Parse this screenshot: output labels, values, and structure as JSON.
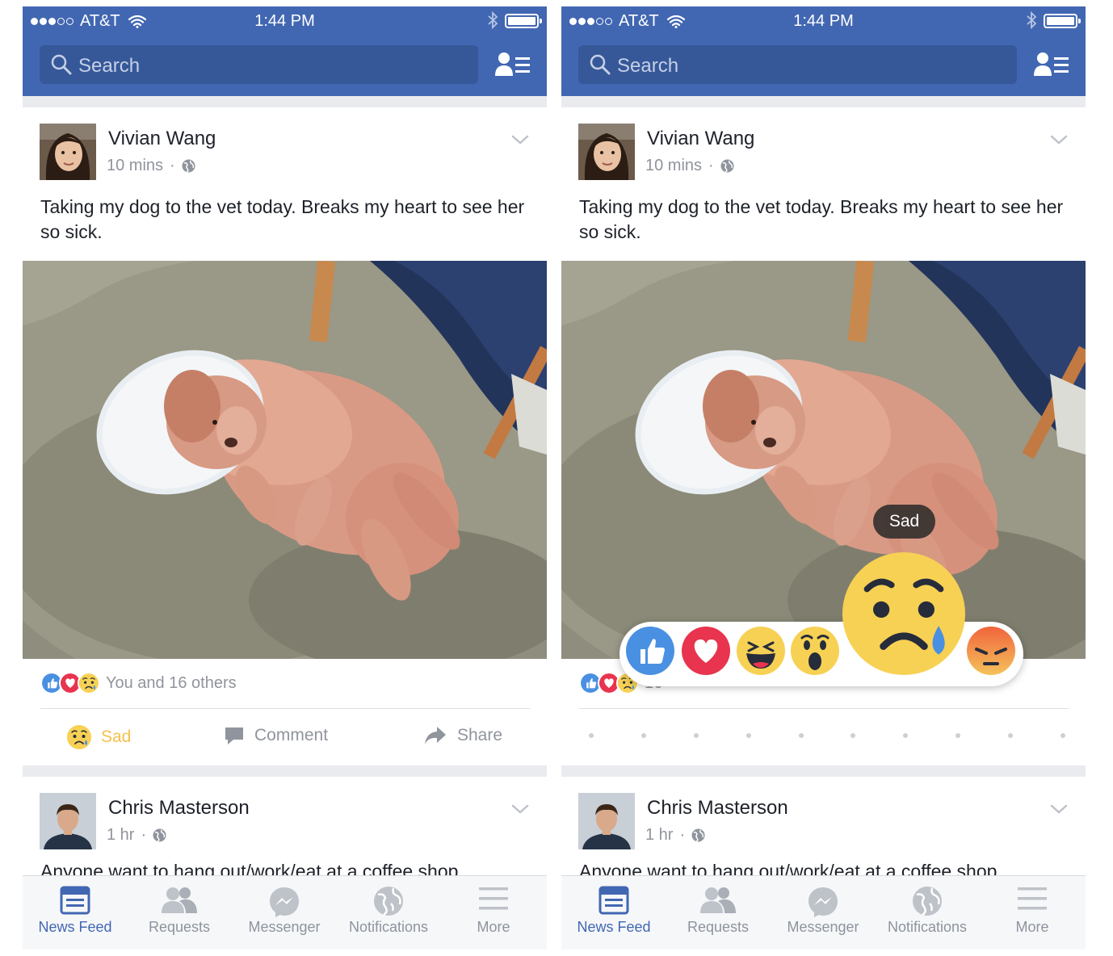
{
  "status_bar": {
    "carrier": "AT&T",
    "time": "1:44 PM"
  },
  "header": {
    "search_placeholder": "Search"
  },
  "posts": [
    {
      "author": "Vivian Wang",
      "time": "10 mins",
      "text": "Taking my dog to the vet today. Breaks my heart to see her so sick.",
      "reaction_summary": "You and 16 others",
      "reaction_summary_partial": "16",
      "actions": {
        "like_label": "Sad",
        "comment_label": "Comment",
        "share_label": "Share"
      }
    },
    {
      "author": "Chris Masterson",
      "time": "1 hr",
      "text": "Anyone want to hang out/work/eat at a coffee shop"
    }
  ],
  "reaction_picker": {
    "tooltip": "Sad",
    "reactions": [
      "like",
      "love",
      "haha",
      "wow",
      "sad",
      "angry"
    ],
    "selected": "sad"
  },
  "tabbar": {
    "tabs": [
      {
        "label": "News Feed",
        "icon": "news-feed-icon",
        "active": true
      },
      {
        "label": "Requests",
        "icon": "requests-icon",
        "active": false
      },
      {
        "label": "Messenger",
        "icon": "messenger-icon",
        "active": false
      },
      {
        "label": "Notifications",
        "icon": "globe-icon",
        "active": false
      },
      {
        "label": "More",
        "icon": "menu-icon",
        "active": false
      }
    ]
  },
  "colors": {
    "brand_blue": "#4267b2",
    "search_bg": "#365899",
    "sad_yellow": "#f2c14e",
    "love_red": "#e8344e",
    "like_blue": "#4a90e2",
    "angry_orange": "#f0643c"
  }
}
